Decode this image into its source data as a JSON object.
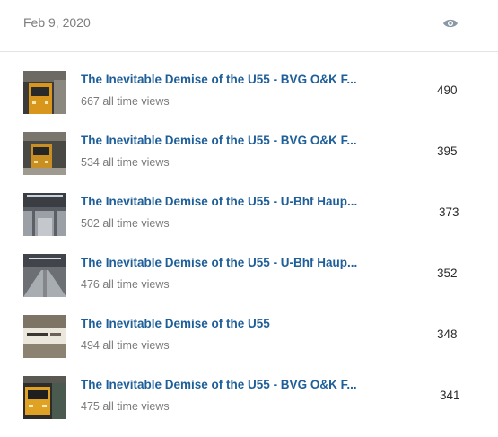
{
  "header": {
    "date": "Feb 9, 2020",
    "views_icon": "eye-icon"
  },
  "rows": [
    {
      "title": "The Inevitable Demise of the U55 - BVG O&K F...",
      "all_time": "667 all time views",
      "count": "490",
      "thumb": "train-yellow"
    },
    {
      "title": "The Inevitable Demise of the U55 - BVG O&K F...",
      "all_time": "534 all time views",
      "count": "395",
      "thumb": "train-yellow"
    },
    {
      "title": "The Inevitable Demise of the U55 - U-Bhf Haup...",
      "all_time": "502 all time views",
      "count": "373",
      "thumb": "station-hall"
    },
    {
      "title": "The Inevitable Demise of the U55 - U-Bhf Haup...",
      "all_time": "476 all time views",
      "count": "352",
      "thumb": "station-platform"
    },
    {
      "title": "The Inevitable Demise of the U55",
      "all_time": "494 all time views",
      "count": "348",
      "thumb": "station-sign"
    },
    {
      "title": "The Inevitable Demise of the U55 - BVG O&K F...",
      "all_time": "475 all time views",
      "count": "341",
      "thumb": "train-yellow"
    }
  ]
}
